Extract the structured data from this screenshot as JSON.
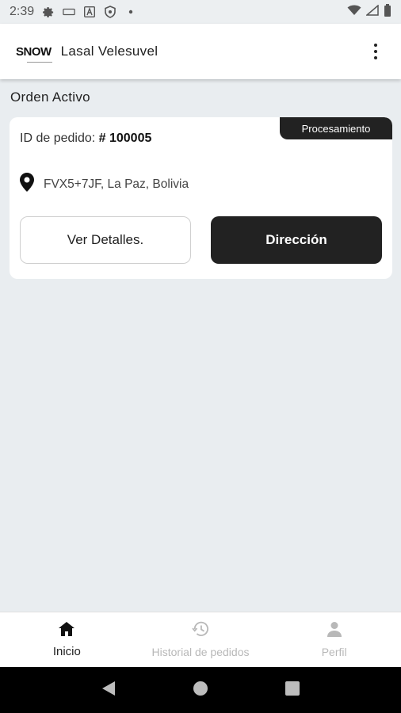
{
  "status_bar": {
    "time": "2:39"
  },
  "app_bar": {
    "logo": "SNOW",
    "title": "Lasal Velesuvel"
  },
  "section": {
    "title": "Orden Activo"
  },
  "order": {
    "status": "Procesamiento",
    "id_label": "ID de pedido: ",
    "id_value": "# 100005",
    "address": "FVX5+7JF, La Paz, Bolivia",
    "details_button": "Ver Detalles.",
    "direction_button": "Dirección"
  },
  "bottom_nav": {
    "items": [
      {
        "label": "Inicio",
        "icon": "home-icon",
        "active": true
      },
      {
        "label": "Historial de pedidos",
        "icon": "history-icon",
        "active": false
      },
      {
        "label": "Perfil",
        "icon": "person-icon",
        "active": false
      }
    ]
  },
  "colors": {
    "accent": "#222222",
    "background": "#e9edf0",
    "inactive": "#b8b8b8"
  }
}
